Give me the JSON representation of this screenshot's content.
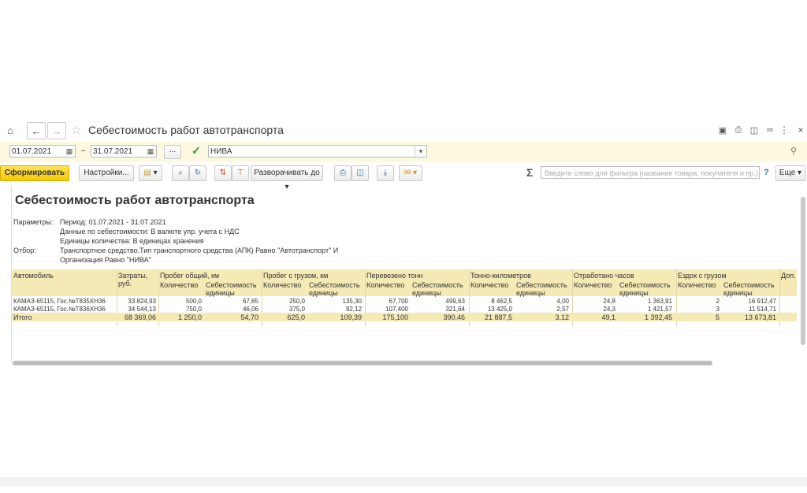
{
  "title": "Себестоимость работ автотранспорта",
  "params": {
    "date_from": "01.07.2021",
    "dash": "–",
    "date_to": "31.07.2021",
    "more": "...",
    "org": "НИВА"
  },
  "toolbar": {
    "generate": "Сформировать",
    "settings": "Настройки...",
    "expand": "Разворачивать до",
    "filter_placeholder": "Введите слово для фильтра (название товара, покупателя и пр.)",
    "help": "?",
    "more": "Еще"
  },
  "report": {
    "title": "Себестоимость работ автотранспорта",
    "params_label": "Параметры:",
    "period": "Период: 01.07.2021 - 31.07.2021",
    "cost_data": "Данные по себестоимости: В валюте упр. учета с НДС",
    "units": "Единицы количества: В единицах хранения",
    "filter_label": "Отбор:",
    "filter_line1": "Транспортное средство.Тип транспортного средства (АПК) Равно \"Автотранспорт\" И",
    "filter_line2": "Организация Равно \"НИВА\""
  },
  "table": {
    "col_car": "Автомобиль",
    "col_costs": "Затраты, руб.",
    "groups": [
      "Пробег общий, км",
      "Пробег с грузом, км",
      "Перевезено тонн",
      "Тонно-километров",
      "Отработано часов",
      "Ездок с грузом",
      "Доп. с"
    ],
    "sub_qty": "Количество",
    "sub_cost": "Себестоимость единицы",
    "rows": [
      [
        "КАМАЗ-65115, Гос.№Т835ХН36",
        "33 824,93",
        "500,0",
        "67,65",
        "250,0",
        "135,30",
        "67,700",
        "499,63",
        "8 462,5",
        "4,00",
        "24,8",
        "1 363,91",
        "2",
        "16 912,47"
      ],
      [
        "КАМАЗ-65115, Гос.№Т836ХН36",
        "34 544,13",
        "750,0",
        "46,06",
        "375,0",
        "92,12",
        "107,400",
        "321,64",
        "13 425,0",
        "2,57",
        "24,3",
        "1 421,57",
        "3",
        "11 514,71"
      ]
    ],
    "total": [
      "Итого",
      "68 369,06",
      "1 250,0",
      "54,70",
      "625,0",
      "109,39",
      "175,100",
      "390,46",
      "21 887,5",
      "3,12",
      "49,1",
      "1 392,45",
      "5",
      "13 673,81"
    ]
  }
}
